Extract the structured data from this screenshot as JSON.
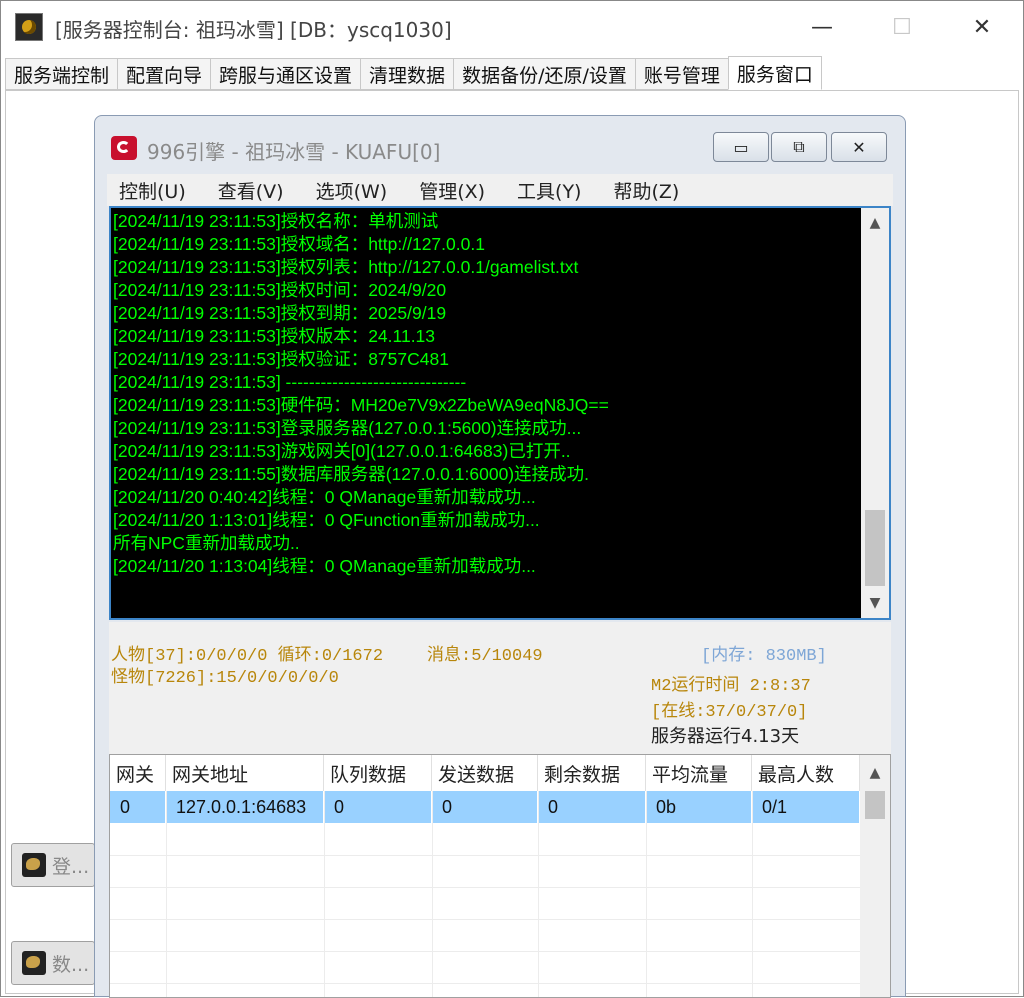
{
  "window": {
    "title": "[服务器控制台: 祖玛冰雪] [DB：yscq1030]",
    "minimize": "—",
    "maximize": "☐",
    "close": "✕"
  },
  "tabs": [
    {
      "label": "服务端控制"
    },
    {
      "label": "配置向导"
    },
    {
      "label": "跨服与通区设置"
    },
    {
      "label": "清理数据"
    },
    {
      "label": "数据备份/还原/设置"
    },
    {
      "label": "账号管理"
    },
    {
      "label": "服务窗口",
      "active": true
    }
  ],
  "side_buttons": [
    {
      "label": "登..."
    },
    {
      "label": "数..."
    }
  ],
  "inner_window": {
    "title": "996引擎 - 祖玛冰雪 - KUAFU[0]",
    "buttons": {
      "minimize": "▭",
      "restore": "⧉",
      "close": "✕"
    },
    "menu": [
      "控制(U)",
      "查看(V)",
      "选项(W)",
      "管理(X)",
      "工具(Y)",
      "帮助(Z)"
    ],
    "log": [
      "[2024/11/19 23:11:53]授权名称：单机测试",
      "[2024/11/19 23:11:53]授权域名：http://127.0.0.1",
      "[2024/11/19 23:11:53]授权列表：http://127.0.0.1/gamelist.txt",
      "[2024/11/19 23:11:53]授权时间：2024/9/20",
      "[2024/11/19 23:11:53]授权到期：2025/9/19",
      "[2024/11/19 23:11:53]授权版本：24.11.13",
      "[2024/11/19 23:11:53]授权验证：8757C481",
      "[2024/11/19 23:11:53] -------------------------------",
      "[2024/11/19 23:11:53]硬件码：MH20e7V9x2ZbeWA9eqN8JQ==",
      "[2024/11/19 23:11:53]登录服务器(127.0.0.1:5600)连接成功...",
      "[2024/11/19 23:11:53]游戏网关[0](127.0.0.1:64683)已打开..",
      "[2024/11/19 23:11:55]数据库服务器(127.0.0.1:6000)连接成功.",
      "[2024/11/20 0:40:42]线程：0 QManage重新加载成功...",
      "[2024/11/20 1:13:01]线程：0 QFunction重新加载成功...",
      "所有NPC重新加载成功..",
      "[2024/11/20 1:13:04]线程：0 QManage重新加载成功..."
    ],
    "status": {
      "people": "人物[37]:0/0/0/0 循环:0/1672",
      "messages": "消息:5/10049",
      "monsters": "怪物[7226]:15/0/0/0/0/0",
      "memory": "[内存: 830MB]",
      "m2_runtime": "M2运行时间 2:8:37",
      "online": "[在线:37/0/37/0]",
      "server_runtime": "服务器运行4.13天"
    },
    "table": {
      "columns": [
        "网关",
        "网关地址",
        "队列数据",
        "发送数据",
        "剩余数据",
        "平均流量",
        "最高人数"
      ],
      "rows": [
        [
          "0",
          "127.0.0.1:64683",
          "0",
          "0",
          "0",
          "0b",
          "0/1"
        ]
      ]
    }
  },
  "icons": {
    "app": "game-app-icon",
    "inner": "engine-app-icon",
    "scroll_up": "▲",
    "scroll_down": "▼"
  },
  "colors": {
    "log_text": "#00ff00",
    "console_bg": "#000000",
    "status_orange": "#b8860b",
    "status_blue": "#7ea6d6",
    "selected_row": "#99d1ff"
  }
}
